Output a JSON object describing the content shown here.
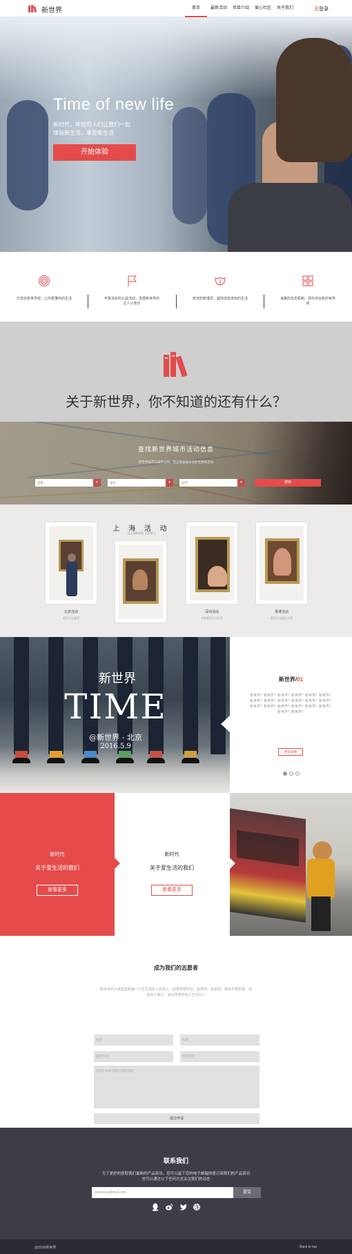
{
  "colors": {
    "accent": "#e54b4b",
    "footer_bg": "#3c3d47",
    "band_gray": "#cfcfcf"
  },
  "header": {
    "logo_text": "新世界",
    "nav": [
      "首页",
      "最新活动",
      "项目介绍",
      "爱心社区",
      "关于我们"
    ],
    "login": "登录"
  },
  "hero": {
    "title": "Time of new life",
    "subtitle_line1": "新时代，年轻的人们让我们一起",
    "subtitle_line2": "体验新生活，享受新生活",
    "cta": "开始体验"
  },
  "features": [
    {
      "icon": "target-icon",
      "text": "打造全新世界观，让你更懂你的生活"
    },
    {
      "icon": "flag-icon",
      "text": "丰富多彩的公益活动，发展新世界的主人公意识"
    },
    {
      "icon": "lotus-icon",
      "text": "积淀的新理念，超前体验未知的生活"
    },
    {
      "icon": "grid-icon",
      "text": "海量的信息机制，领先你全新的世界观"
    }
  ],
  "about": {
    "title": "关于新世界，你不知道的还有什么？"
  },
  "map_search": {
    "title": "查找新世界城市活动信息",
    "subtitle": "新世界城市与城市之间，是这样直接体现新世界的活动",
    "selects": [
      "国家",
      "省份",
      "城市"
    ],
    "button": "搜索"
  },
  "gallery": {
    "title": "上 海 活 动",
    "subtitle": "让上海新体验 让梦想飞",
    "items": [
      {
        "name": "北京活动",
        "desc": "看到活动展馆"
      },
      {
        "name": "深圳活动",
        "desc": "全新看到活动信息"
      },
      {
        "name": "香港活动",
        "desc": "看到活动展区信息"
      }
    ]
  },
  "time_section": {
    "overlay_title": "新世界",
    "overlay_big": "TIME",
    "overlay_place": "@新世界 - 北京",
    "overlay_date": "2016.5.9",
    "card_title": "新世界/",
    "card_num": "01",
    "card_body": "新世界？新世界？新世界？新世界？新世界？新世界？新世界？新世界？新世界？新世界？新世界？新世界？新世界？新世界？新世界？新世界？新世界？新世界？新世界？新世界？",
    "card_btn": "更多详情",
    "dots": 3
  },
  "panels": [
    {
      "t1": "新时代",
      "t2": "关于爱生活的我们",
      "btn": "查看更多"
    },
    {
      "t1": "新时代",
      "t2": "关于爱生活的我们",
      "btn": "查看更多"
    }
  ],
  "volunteer": {
    "title": "成为我们的志愿者",
    "desc": "新世界的大家庭需要每一个爱生活的人的加入，如果你够年轻，有梦想，有激情，那就不要犹豫，快来加入我们，成为改变所有人生活的人",
    "fields": [
      "姓名：",
      "年龄：",
      "联系方式：",
      "所在地区：",
      "您有什么想对我们说的话呢："
    ],
    "submit": "提交申请"
  },
  "footer": {
    "title": "联系我们",
    "desc_line1": "为了更好的获取我们最新的产品资讯，您可以留下您的电子邮箱快速订阅我们的产品资讯",
    "desc_line2": "也可以通过以下任何方式关注我们的动态",
    "email_placeholder": "someone@mail.com",
    "submit": "提交",
    "social": [
      "qq-icon",
      "weibo-icon",
      "twitter-icon",
      "dribbble-icon"
    ],
    "copyright": "@2016新世界",
    "back_to_top": "Back to top"
  }
}
